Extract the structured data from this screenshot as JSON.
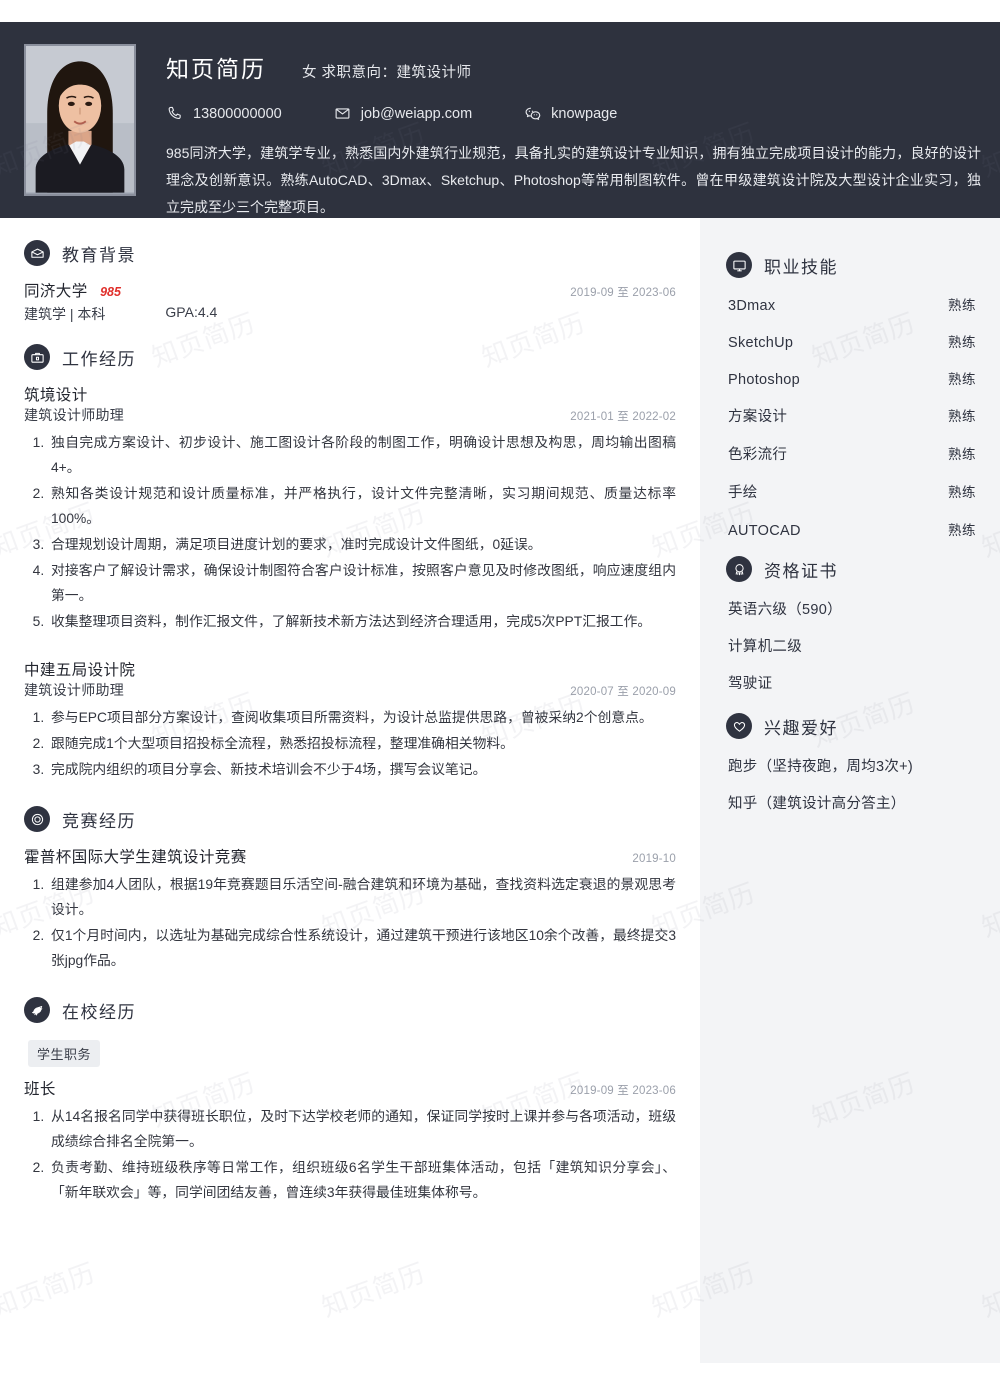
{
  "theme": {
    "header_bg": "#2e323e",
    "sidebar_bg": "#f3f4f6",
    "accent_red": "#e0302c",
    "text_dark": "#2f3340",
    "date_gray": "#9ba0ab"
  },
  "watermark": {
    "text": "知页简历"
  },
  "header": {
    "name": "知页简历",
    "meta": "女 求职意向：建筑设计师",
    "contacts": [
      {
        "icon": "phone-icon",
        "value": "13800000000"
      },
      {
        "icon": "envelope-icon",
        "value": "job@weiapp.com"
      },
      {
        "icon": "wechat-icon",
        "value": "knowpage"
      }
    ],
    "summary": "985同济大学，建筑学专业，熟悉国内外建筑行业规范，具备扎实的建筑设计专业知识，拥有独立完成项目设计的能力，良好的设计理念及创新意识。熟练AutoCAD、3Dmax、Sketchup、Photoshop等常用制图软件。曾在甲级建筑设计院及大型设计企业实习，独立完成至少三个完整项目。"
  },
  "main": {
    "education": {
      "icon": "graduation-cap-icon",
      "title": "教育背景",
      "school": "同济大学",
      "badge": "985",
      "date": "2019-09 至 2023-06",
      "major": "建筑学 | 本科",
      "gpa": "GPA:4.4"
    },
    "work": {
      "icon": "briefcase-icon",
      "title": "工作经历",
      "entries": [
        {
          "org": "筑境设计",
          "role": "建筑设计师助理",
          "date": "2021-01 至 2022-02",
          "bullets": [
            "独自完成方案设计、初步设计、施工图设计各阶段的制图工作，明确设计思想及构思，周均输出图稿4+。",
            "熟知各类设计规范和设计质量标准，并严格执行，设计文件完整清晰，实习期间规范、质量达标率100%。",
            "合理规划设计周期，满足项目进度计划的要求，准时完成设计文件图纸，0延误。",
            "对接客户了解设计需求，确保设计制图符合客户设计标准，按照客户意见及时修改图纸，响应速度组内第一。",
            "收集整理项目资料，制作汇报文件，了解新技术新方法达到经济合理适用，完成5次PPT汇报工作。"
          ]
        },
        {
          "org": "中建五局设计院",
          "role": "建筑设计师助理",
          "date": "2020-07 至 2020-09",
          "bullets": [
            "参与EPC项目部分方案设计，查阅收集项目所需资料，为设计总监提供思路，曾被采纳2个创意点。",
            "跟随完成1个大型项目招投标全流程，熟悉招投标流程，整理准确相关物料。",
            "完成院内组织的项目分享会、新技术培训会不少于4场，撰写会议笔记。"
          ]
        }
      ]
    },
    "competition": {
      "icon": "target-icon",
      "title": "竞赛经历",
      "entries": [
        {
          "org": "霍普杯国际大学生建筑设计竞赛",
          "date": "2019-10",
          "bullets": [
            "组建参加4人团队，根据19年竞赛题目乐活空间-融合建筑和环境为基础，查找资料选定衰退的景观思考设计。",
            "仅1个月时间内，以选址为基础完成综合性系统设计，通过建筑干预进行该地区10余个改善，最终提交3张jpg作品。"
          ]
        }
      ]
    },
    "campus": {
      "icon": "bird-icon",
      "title": "在校经历",
      "tag": "学生职务",
      "entries": [
        {
          "org": "班长",
          "date": "2019-09 至 2023-06",
          "bullets": [
            "从14名报名同学中获得班长职位，及时下达学校老师的通知，保证同学按时上课并参与各项活动，班级成绩综合排名全院第一。",
            "负责考勤、维持班级秩序等日常工作，组织班级6名学生干部班集体活动，包括「建筑知识分享会」、「新年联欢会」等，同学间团结友善，曾连续3年获得最佳班集体称号。"
          ]
        }
      ]
    }
  },
  "sidebar": {
    "skills": {
      "icon": "monitor-icon",
      "title": "职业技能",
      "items": [
        {
          "name": "3Dmax",
          "level": "熟练"
        },
        {
          "name": "SketchUp",
          "level": "熟练"
        },
        {
          "name": "Photoshop",
          "level": "熟练"
        },
        {
          "name": "方案设计",
          "level": "熟练"
        },
        {
          "name": "色彩流行",
          "level": "熟练"
        },
        {
          "name": "手绘",
          "level": "熟练"
        },
        {
          "name": "AUTOCAD",
          "level": "熟练"
        }
      ]
    },
    "certificates": {
      "icon": "award-medal-icon",
      "title": "资格证书",
      "items": [
        "英语六级（590）",
        "计算机二级",
        "驾驶证"
      ]
    },
    "hobbies": {
      "icon": "heart-icon",
      "title": "兴趣爱好",
      "items": [
        "跑步（坚持夜跑，周均3次+)",
        "知乎（建筑设计高分答主）"
      ]
    }
  }
}
